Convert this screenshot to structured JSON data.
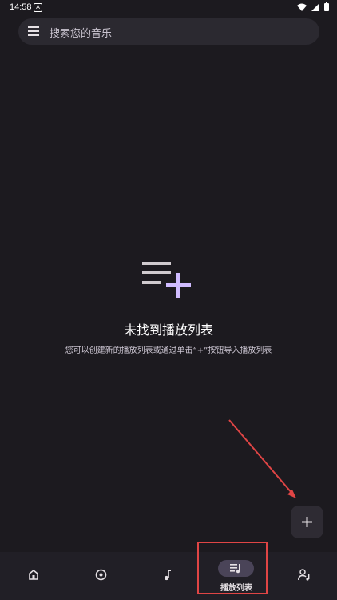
{
  "status_bar": {
    "time": "14:58",
    "notification_letter": "A"
  },
  "search": {
    "placeholder": "搜索您的音乐"
  },
  "empty_state": {
    "title": "未找到播放列表",
    "description": "您可以创建新的播放列表或通过单击“+”按钮导入播放列表"
  },
  "fab": {
    "label": "+"
  },
  "bottom_nav": {
    "items": [
      {
        "icon": "home-icon"
      },
      {
        "icon": "album-icon"
      },
      {
        "icon": "music-note-icon"
      },
      {
        "icon": "playlist-icon",
        "label": "播放列表",
        "selected": true
      },
      {
        "icon": "artist-icon"
      }
    ]
  },
  "colors": {
    "background": "#1c1a1f",
    "accent": "#d0bcff",
    "annotation": "#e04545"
  }
}
